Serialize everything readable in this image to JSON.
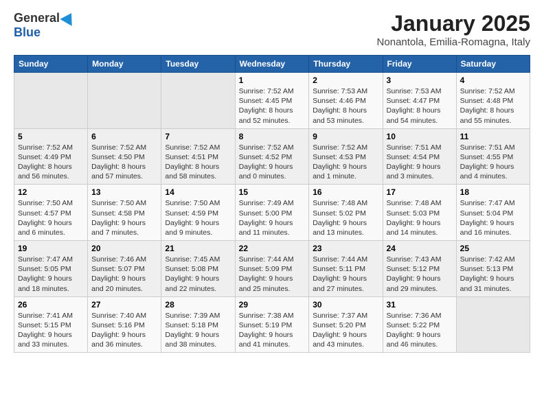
{
  "logo": {
    "general": "General",
    "blue": "Blue"
  },
  "title": "January 2025",
  "subtitle": "Nonantola, Emilia-Romagna, Italy",
  "days_header": [
    "Sunday",
    "Monday",
    "Tuesday",
    "Wednesday",
    "Thursday",
    "Friday",
    "Saturday"
  ],
  "weeks": [
    [
      {
        "day": "",
        "content": ""
      },
      {
        "day": "",
        "content": ""
      },
      {
        "day": "",
        "content": ""
      },
      {
        "day": "1",
        "content": "Sunrise: 7:52 AM\nSunset: 4:45 PM\nDaylight: 8 hours and 52 minutes."
      },
      {
        "day": "2",
        "content": "Sunrise: 7:53 AM\nSunset: 4:46 PM\nDaylight: 8 hours and 53 minutes."
      },
      {
        "day": "3",
        "content": "Sunrise: 7:53 AM\nSunset: 4:47 PM\nDaylight: 8 hours and 54 minutes."
      },
      {
        "day": "4",
        "content": "Sunrise: 7:52 AM\nSunset: 4:48 PM\nDaylight: 8 hours and 55 minutes."
      }
    ],
    [
      {
        "day": "5",
        "content": "Sunrise: 7:52 AM\nSunset: 4:49 PM\nDaylight: 8 hours and 56 minutes."
      },
      {
        "day": "6",
        "content": "Sunrise: 7:52 AM\nSunset: 4:50 PM\nDaylight: 8 hours and 57 minutes."
      },
      {
        "day": "7",
        "content": "Sunrise: 7:52 AM\nSunset: 4:51 PM\nDaylight: 8 hours and 58 minutes."
      },
      {
        "day": "8",
        "content": "Sunrise: 7:52 AM\nSunset: 4:52 PM\nDaylight: 9 hours and 0 minutes."
      },
      {
        "day": "9",
        "content": "Sunrise: 7:52 AM\nSunset: 4:53 PM\nDaylight: 9 hours and 1 minute."
      },
      {
        "day": "10",
        "content": "Sunrise: 7:51 AM\nSunset: 4:54 PM\nDaylight: 9 hours and 3 minutes."
      },
      {
        "day": "11",
        "content": "Sunrise: 7:51 AM\nSunset: 4:55 PM\nDaylight: 9 hours and 4 minutes."
      }
    ],
    [
      {
        "day": "12",
        "content": "Sunrise: 7:50 AM\nSunset: 4:57 PM\nDaylight: 9 hours and 6 minutes."
      },
      {
        "day": "13",
        "content": "Sunrise: 7:50 AM\nSunset: 4:58 PM\nDaylight: 9 hours and 7 minutes."
      },
      {
        "day": "14",
        "content": "Sunrise: 7:50 AM\nSunset: 4:59 PM\nDaylight: 9 hours and 9 minutes."
      },
      {
        "day": "15",
        "content": "Sunrise: 7:49 AM\nSunset: 5:00 PM\nDaylight: 9 hours and 11 minutes."
      },
      {
        "day": "16",
        "content": "Sunrise: 7:48 AM\nSunset: 5:02 PM\nDaylight: 9 hours and 13 minutes."
      },
      {
        "day": "17",
        "content": "Sunrise: 7:48 AM\nSunset: 5:03 PM\nDaylight: 9 hours and 14 minutes."
      },
      {
        "day": "18",
        "content": "Sunrise: 7:47 AM\nSunset: 5:04 PM\nDaylight: 9 hours and 16 minutes."
      }
    ],
    [
      {
        "day": "19",
        "content": "Sunrise: 7:47 AM\nSunset: 5:05 PM\nDaylight: 9 hours and 18 minutes."
      },
      {
        "day": "20",
        "content": "Sunrise: 7:46 AM\nSunset: 5:07 PM\nDaylight: 9 hours and 20 minutes."
      },
      {
        "day": "21",
        "content": "Sunrise: 7:45 AM\nSunset: 5:08 PM\nDaylight: 9 hours and 22 minutes."
      },
      {
        "day": "22",
        "content": "Sunrise: 7:44 AM\nSunset: 5:09 PM\nDaylight: 9 hours and 25 minutes."
      },
      {
        "day": "23",
        "content": "Sunrise: 7:44 AM\nSunset: 5:11 PM\nDaylight: 9 hours and 27 minutes."
      },
      {
        "day": "24",
        "content": "Sunrise: 7:43 AM\nSunset: 5:12 PM\nDaylight: 9 hours and 29 minutes."
      },
      {
        "day": "25",
        "content": "Sunrise: 7:42 AM\nSunset: 5:13 PM\nDaylight: 9 hours and 31 minutes."
      }
    ],
    [
      {
        "day": "26",
        "content": "Sunrise: 7:41 AM\nSunset: 5:15 PM\nDaylight: 9 hours and 33 minutes."
      },
      {
        "day": "27",
        "content": "Sunrise: 7:40 AM\nSunset: 5:16 PM\nDaylight: 9 hours and 36 minutes."
      },
      {
        "day": "28",
        "content": "Sunrise: 7:39 AM\nSunset: 5:18 PM\nDaylight: 9 hours and 38 minutes."
      },
      {
        "day": "29",
        "content": "Sunrise: 7:38 AM\nSunset: 5:19 PM\nDaylight: 9 hours and 41 minutes."
      },
      {
        "day": "30",
        "content": "Sunrise: 7:37 AM\nSunset: 5:20 PM\nDaylight: 9 hours and 43 minutes."
      },
      {
        "day": "31",
        "content": "Sunrise: 7:36 AM\nSunset: 5:22 PM\nDaylight: 9 hours and 46 minutes."
      },
      {
        "day": "",
        "content": ""
      }
    ]
  ]
}
